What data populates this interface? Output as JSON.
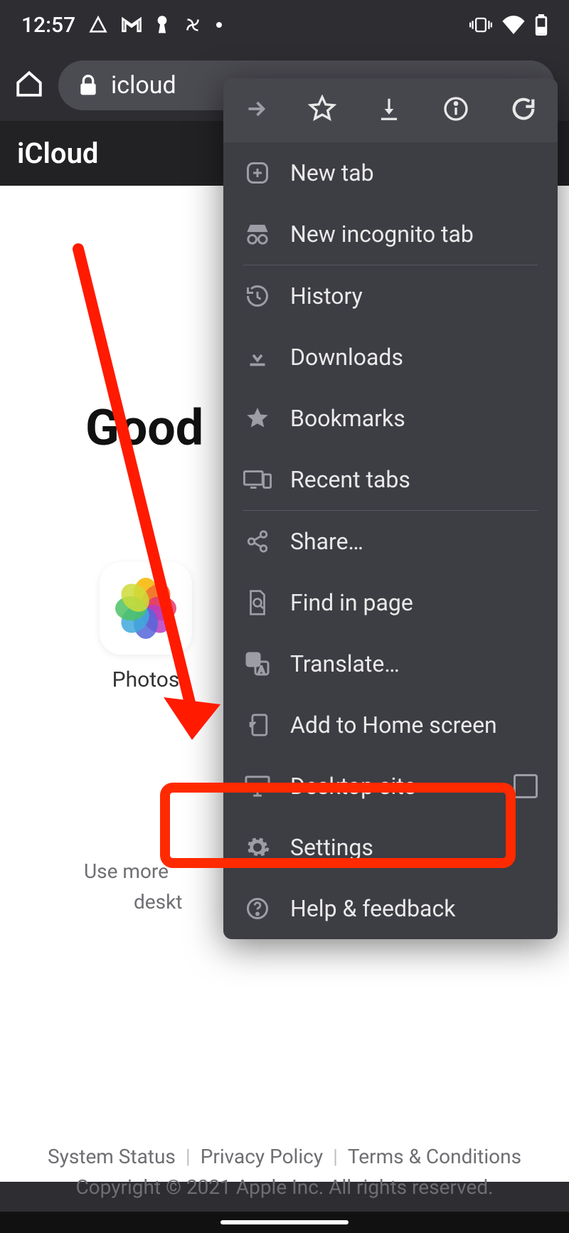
{
  "status_bar": {
    "time": "12:57"
  },
  "browser": {
    "url_display": "icloud"
  },
  "page": {
    "header_title": "iCloud",
    "greeting_prefix": "Good",
    "app_photos_label": "Photos",
    "hint_line1": "Use more",
    "hint_line2": "deskt"
  },
  "footer": {
    "links": [
      "System Status",
      "Privacy Policy",
      "Terms & Conditions"
    ],
    "copyright": "Copyright © 2021 Apple Inc. All rights reserved."
  },
  "menu": {
    "items": {
      "new_tab": "New tab",
      "incognito": "New incognito tab",
      "history": "History",
      "downloads": "Downloads",
      "bookmarks": "Bookmarks",
      "recent_tabs": "Recent tabs",
      "share": "Share…",
      "find": "Find in page",
      "translate": "Translate…",
      "add_home": "Add to Home screen",
      "desktop_site": "Desktop site",
      "settings": "Settings",
      "help": "Help & feedback"
    }
  }
}
